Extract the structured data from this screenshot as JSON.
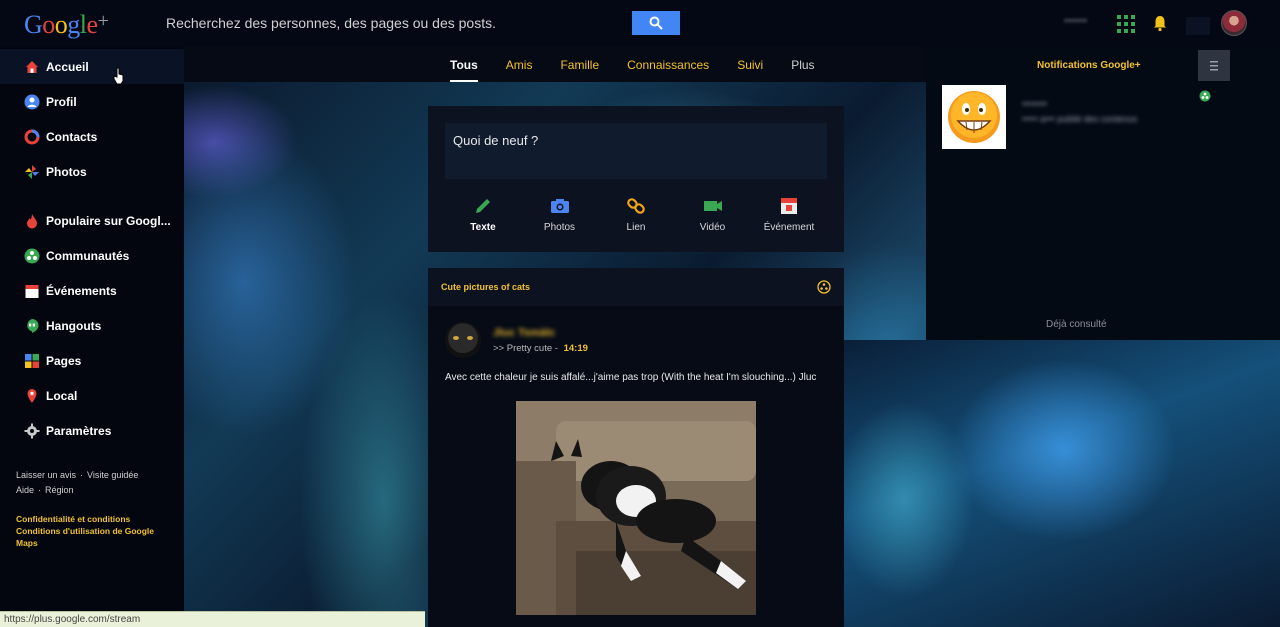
{
  "app": {
    "logo_letters": [
      "G",
      "o",
      "o",
      "g",
      "l",
      "e"
    ],
    "logo_plus": "+"
  },
  "search": {
    "placeholder": "Recherchez des personnes, des pages ou des posts.",
    "icon": "search-icon"
  },
  "header": {
    "user_name_blurred": "••••••",
    "icons": [
      "apps-grid-icon",
      "notification-bell-icon",
      "avatar"
    ]
  },
  "sidebar": {
    "items": [
      {
        "label": "Accueil",
        "icon": "home-icon",
        "active": true
      },
      {
        "label": "Profil",
        "icon": "profile-icon"
      },
      {
        "label": "Contacts",
        "icon": "contacts-icon"
      },
      {
        "label": "Photos",
        "icon": "photos-icon"
      },
      {
        "label": "Populaire sur Googl...",
        "icon": "flame-icon"
      },
      {
        "label": "Communautés",
        "icon": "communities-icon"
      },
      {
        "label": "Événements",
        "icon": "calendar-icon"
      },
      {
        "label": "Hangouts",
        "icon": "hangouts-icon"
      },
      {
        "label": "Pages",
        "icon": "pages-icon"
      },
      {
        "label": "Local",
        "icon": "map-pin-icon"
      },
      {
        "label": "Paramètres",
        "icon": "gear-icon"
      }
    ],
    "footer": {
      "links_row1": [
        "Laisser un avis",
        "Visite guidée"
      ],
      "links_row2": [
        "Aide",
        "Région"
      ],
      "legal_1": "Confidentialité et conditions",
      "legal_2": "Conditions d'utilisation de Google Maps"
    }
  },
  "tabs": [
    {
      "label": "Tous",
      "active": true
    },
    {
      "label": "Amis"
    },
    {
      "label": "Famille"
    },
    {
      "label": "Connaissances"
    },
    {
      "label": "Suivi"
    },
    {
      "label": "Plus"
    }
  ],
  "share_box": {
    "placeholder": "Quoi de neuf ?",
    "actions": [
      {
        "label": "Texte",
        "icon": "pencil-icon",
        "color": "#3aa853"
      },
      {
        "label": "Photos",
        "icon": "camera-icon",
        "color": "#4b85f0"
      },
      {
        "label": "Lien",
        "icon": "link-icon",
        "color": "#f2a51a"
      },
      {
        "label": "Vidéo",
        "icon": "video-icon",
        "color": "#3aa853"
      },
      {
        "label": "Événement",
        "icon": "event-icon",
        "color": "#e8433a"
      }
    ]
  },
  "post": {
    "community": "Cute pictures of cats",
    "author_blurred": "Jluc Tsmàlc",
    "category": ">> Pretty cute",
    "separator": "-",
    "time": "14:19",
    "text": "Avec cette chaleur je suis affalé...j'aime pas trop (With the heat I'm slouching...) Jluc",
    "image_alt": "black-and-white cat lying on couch"
  },
  "notifications": {
    "title": "Notifications Google+",
    "item_line1_blurred": "••••••••",
    "item_line2_blurred": "••••• a••• publié des contenus",
    "seen_label": "Déjà consulté"
  },
  "status_bar": {
    "url": "https://plus.google.com/stream"
  },
  "colors": {
    "accent_yellow": "#f2c12e",
    "search_button": "#4285f4",
    "background": "#050a14"
  }
}
